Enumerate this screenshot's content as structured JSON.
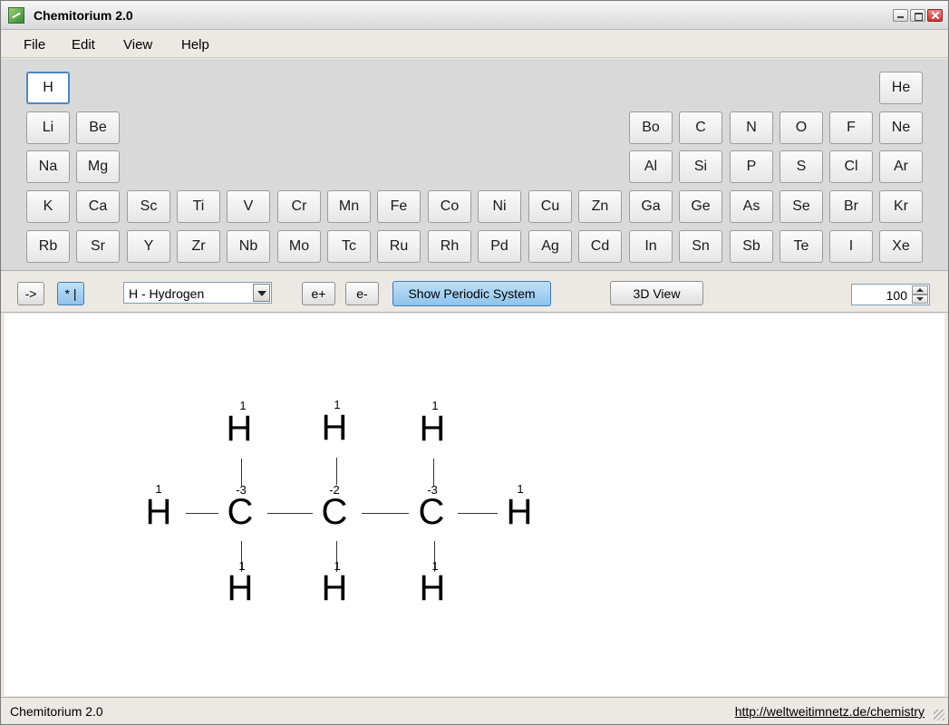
{
  "window": {
    "title": "Chemitorium 2.0"
  },
  "menu": [
    "File",
    "Edit",
    "View",
    "Help"
  ],
  "periodic": {
    "selected": "H",
    "rows": [
      [
        "H",
        "He"
      ],
      [
        "Li",
        "Be",
        "Bo",
        "C",
        "N",
        "O",
        "F",
        "Ne"
      ],
      [
        "Na",
        "Mg",
        "Al",
        "Si",
        "P",
        "S",
        "Cl",
        "Ar"
      ],
      [
        "K",
        "Ca",
        "Sc",
        "Ti",
        "V",
        "Cr",
        "Mn",
        "Fe",
        "Co",
        "Ni",
        "Cu",
        "Zn",
        "Ga",
        "Ge",
        "As",
        "Se",
        "Br",
        "Kr"
      ],
      [
        "Rb",
        "Sr",
        "Y",
        "Zr",
        "Nb",
        "Mo",
        "Tc",
        "Ru",
        "Rh",
        "Pd",
        "Ag",
        "Cd",
        "In",
        "Sn",
        "Sb",
        "Te",
        "I",
        "Xe"
      ]
    ]
  },
  "toolbar": {
    "arrow_label": "->",
    "star_label": "* |",
    "element_select": "H - Hydrogen",
    "eplus_label": "e+",
    "eminus_label": "e-",
    "show_periodic_label": "Show Periodic System",
    "view3d_label": "3D View",
    "zoom_value": "100"
  },
  "molecule": {
    "top_h": [
      {
        "symbol": "H",
        "charge": "1"
      },
      {
        "symbol": "H",
        "charge": "1"
      },
      {
        "symbol": "H",
        "charge": "1"
      }
    ],
    "chain": [
      {
        "symbol": "H",
        "charge": "1"
      },
      {
        "symbol": "C",
        "charge": "-3"
      },
      {
        "symbol": "C",
        "charge": "-2"
      },
      {
        "symbol": "C",
        "charge": "-3"
      },
      {
        "symbol": "H",
        "charge": "1"
      }
    ],
    "bottom_h": [
      {
        "symbol": "H",
        "charge": "1"
      },
      {
        "symbol": "H",
        "charge": "1"
      },
      {
        "symbol": "H",
        "charge": "1"
      }
    ]
  },
  "status": {
    "left": "Chemitorium 2.0",
    "link": "http://weltweitimnetz.de/chemistry"
  },
  "colors": {
    "active_button": "#8fc3ec",
    "selected_border": "#4a87c8"
  }
}
